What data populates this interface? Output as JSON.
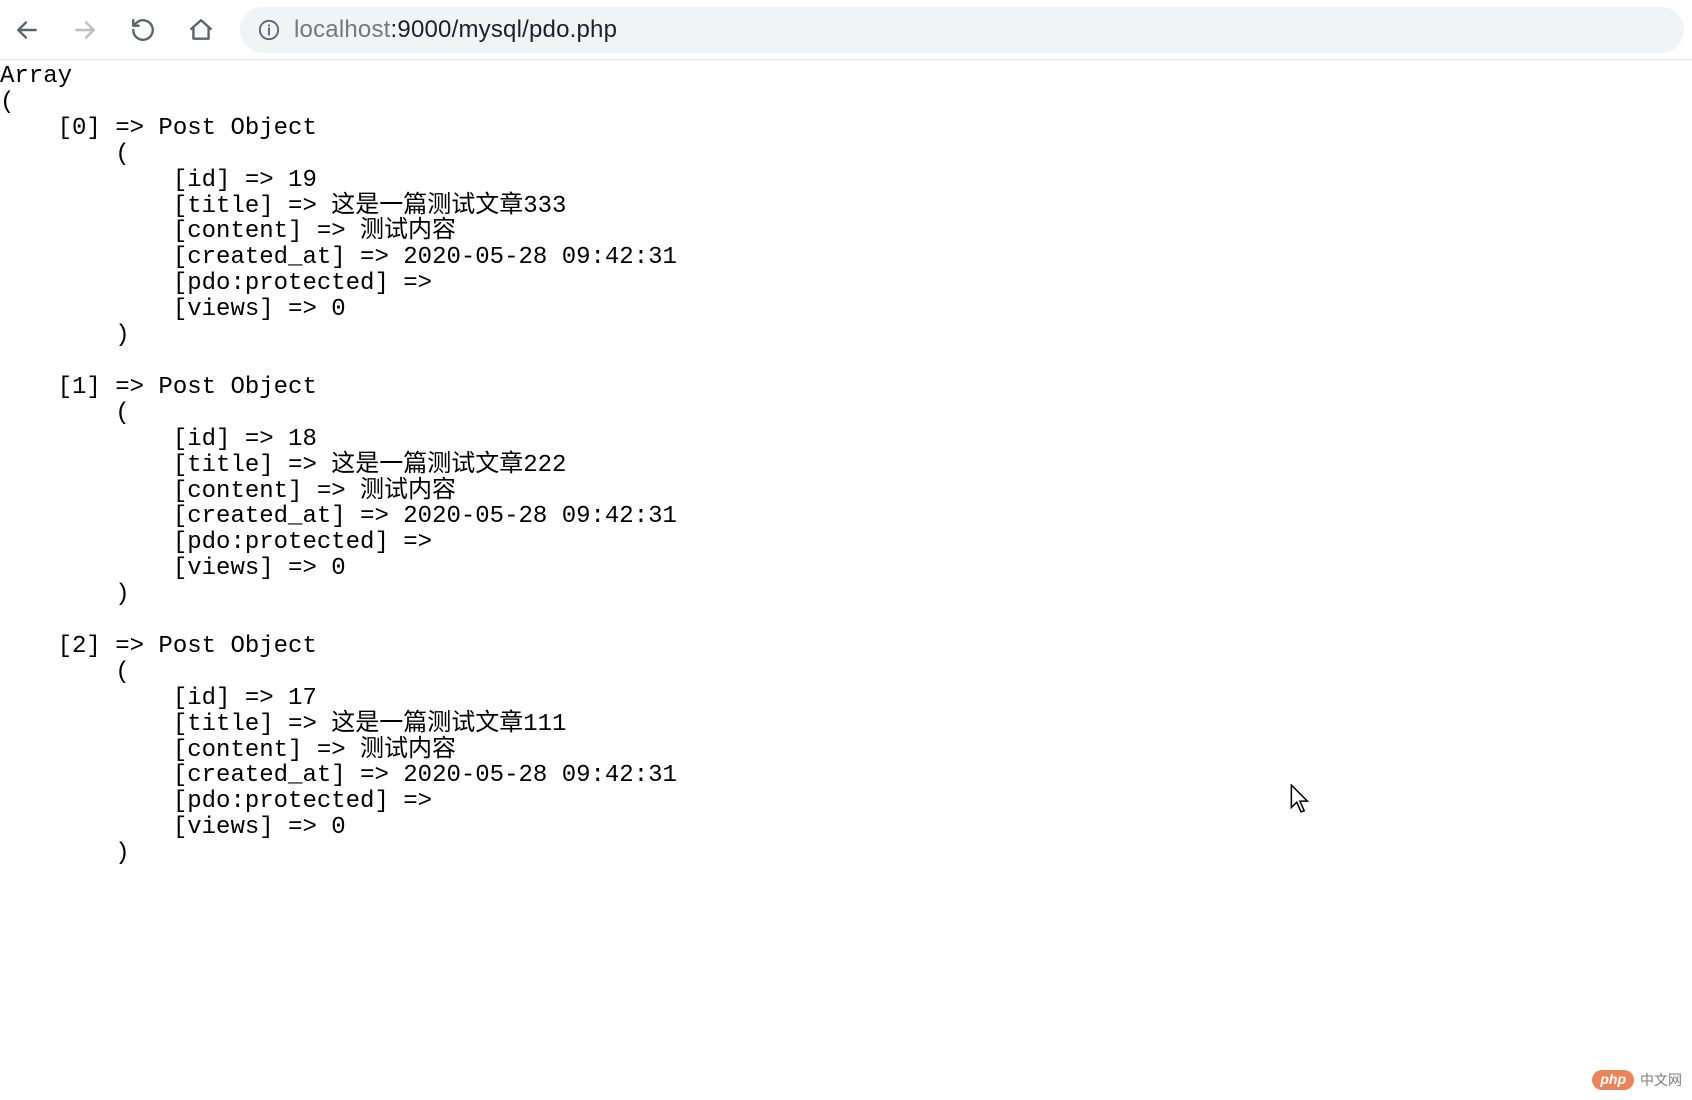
{
  "address": {
    "host": "localhost",
    "path": ":9000/mysql/pdo.php"
  },
  "watermark": {
    "pill": "php",
    "text": "中文网"
  },
  "dump": {
    "root_label": "Array",
    "object_label": "Post Object",
    "items": [
      {
        "index": 0,
        "fields": {
          "id": "19",
          "title": "这是一篇测试文章333",
          "content": "测试内容",
          "created_at": "2020-05-28 09:42:31",
          "pdo_protected": "",
          "views": "0"
        }
      },
      {
        "index": 1,
        "fields": {
          "id": "18",
          "title": "这是一篇测试文章222",
          "content": "测试内容",
          "created_at": "2020-05-28 09:42:31",
          "pdo_protected": "",
          "views": "0"
        }
      },
      {
        "index": 2,
        "fields": {
          "id": "17",
          "title": "这是一篇测试文章111",
          "content": "测试内容",
          "created_at": "2020-05-28 09:42:31",
          "pdo_protected": "",
          "views": "0"
        }
      }
    ],
    "field_labels": {
      "id": "[id]",
      "title": "[title]",
      "content": "[content]",
      "created_at": "[created_at]",
      "pdo_protected": "[pdo:protected]",
      "views": "[views]"
    }
  }
}
